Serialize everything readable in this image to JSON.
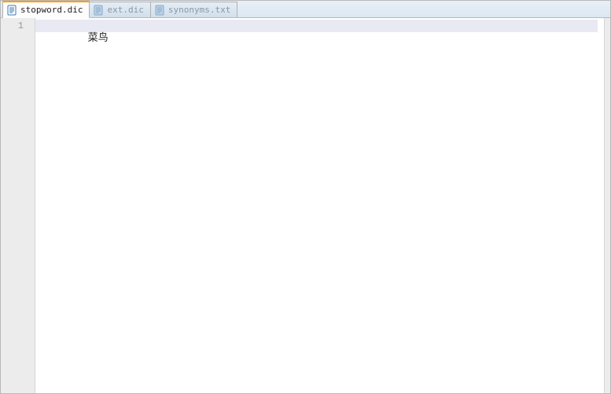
{
  "tabs": [
    {
      "label": "stopword.dic",
      "active": true
    },
    {
      "label": "ext.dic",
      "active": false
    },
    {
      "label": "synonyms.txt",
      "active": false
    }
  ],
  "gutter": {
    "line1": "1"
  },
  "editor": {
    "lines": {
      "l1": "菜鸟"
    }
  }
}
